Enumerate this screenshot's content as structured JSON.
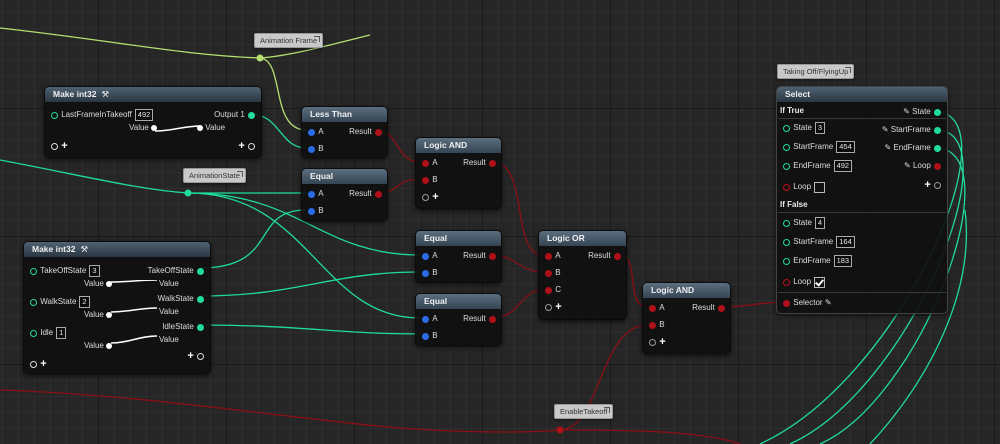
{
  "comments": {
    "animation_frame": "Animation Frame",
    "animation_state": "AnimationState",
    "taking_off": "Taking Off/FlyingUp",
    "enable_takeoff": "EnableTakeoff"
  },
  "make_int32_a": {
    "title": "Make int32",
    "input_label": "LastFrameInTakeoff",
    "input_value": "492",
    "output_label": "Output 1",
    "value_label": "Value",
    "value_label_right": "Value"
  },
  "make_int32_b": {
    "title": "Make int32",
    "rows": [
      {
        "label": "TakeOffState",
        "value": "3",
        "output": "TakeOffState",
        "value_label": "Value"
      },
      {
        "label": "WalkState",
        "value": "2",
        "output": "WalkState",
        "value_label": "Value"
      },
      {
        "label": "Idle",
        "value": "1",
        "output": "IdleState",
        "value_label": "Value"
      }
    ]
  },
  "less_than": {
    "title": "Less Than",
    "a": "A",
    "b": "B",
    "result": "Result"
  },
  "equal_1": {
    "title": "Equal",
    "a": "A",
    "b": "B",
    "result": "Result"
  },
  "equal_2": {
    "title": "Equal",
    "a": "A",
    "b": "B",
    "result": "Result"
  },
  "equal_3": {
    "title": "Equal",
    "a": "A",
    "b": "B",
    "result": "Result"
  },
  "logic_and_1": {
    "title": "Logic AND",
    "a": "A",
    "b": "B",
    "result": "Result"
  },
  "logic_or": {
    "title": "Logic OR",
    "a": "A",
    "b": "B",
    "c": "C",
    "result": "Result"
  },
  "logic_and_2": {
    "title": "Logic AND",
    "a": "A",
    "b": "B",
    "result": "Result"
  },
  "select": {
    "title": "Select",
    "if_true": "If True",
    "if_false": "If False",
    "true_rows": {
      "state_label": "State",
      "state": "3",
      "start_label": "StartFrame",
      "start": "454",
      "end_label": "EndFrame",
      "end": "492",
      "loop_label": "Loop"
    },
    "false_rows": {
      "state_label": "State",
      "state": "4",
      "start_label": "StartFrame",
      "start": "164",
      "end_label": "EndFrame",
      "end": "183",
      "loop_label": "Loop"
    },
    "outputs": {
      "state": "State",
      "start": "StartFrame",
      "end": "EndFrame",
      "loop": "Loop"
    },
    "selector_label": "Selector"
  },
  "colors": {
    "int_wire": "#1fdc9c",
    "bool_wire": "#8a0f16",
    "float_pin": "#2a6ce6",
    "wire_yellow": "#b5e070"
  }
}
